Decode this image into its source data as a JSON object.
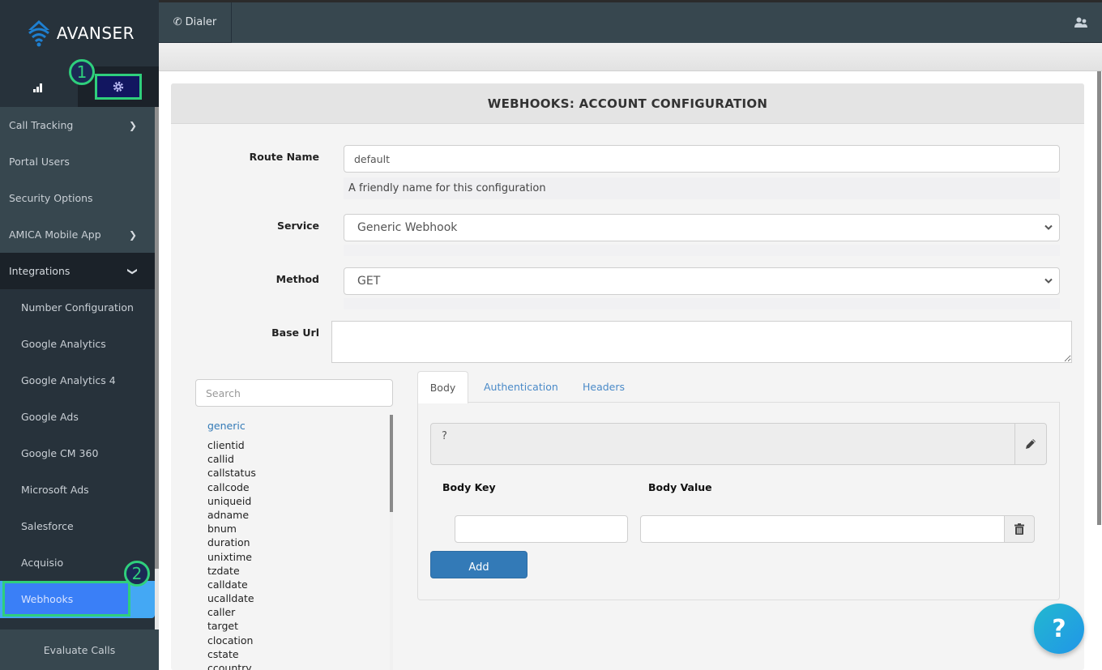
{
  "brand": {
    "name": "AVANSER"
  },
  "sidebar": {
    "tabs": [
      {
        "icon": "bar-chart-icon",
        "label": "Reports"
      },
      {
        "icon": "gear-icon",
        "label": "Settings"
      }
    ],
    "items": [
      {
        "label": "Call Tracking",
        "chevron": "›"
      },
      {
        "label": "Portal Users"
      },
      {
        "label": "Security Options"
      },
      {
        "label": "AMICA Mobile App",
        "chevron": "›"
      },
      {
        "label": "Integrations",
        "chevron": "⌄"
      }
    ],
    "integrations": [
      "Number Configuration",
      "Google Analytics",
      "Google Analytics 4",
      "Google Ads",
      "Google CM 360",
      "Microsoft Ads",
      "Salesforce",
      "Acquisio",
      "Webhooks"
    ],
    "active": "Webhooks",
    "footer": "Evaluate Calls",
    "annotations": {
      "settings": "1",
      "webhooks": "2"
    }
  },
  "topbar": {
    "dialer": "Dialer"
  },
  "page": {
    "title": "WEBHOOKS: ACCOUNT CONFIGURATION",
    "route_name_label": "Route Name",
    "route_name_value": "default",
    "route_name_help": "A friendly name for this configuration",
    "service_label": "Service",
    "service_value": "Generic Webhook",
    "method_label": "Method",
    "method_value": "GET",
    "base_url_label": "Base Url",
    "base_url_value": ""
  },
  "variables": {
    "search_placeholder": "Search",
    "group": "generic",
    "items": [
      "clientid",
      "callid",
      "callstatus",
      "callcode",
      "uniqueid",
      "adname",
      "bnum",
      "duration",
      "unixtime",
      "tzdate",
      "calldate",
      "ucalldate",
      "caller",
      "target",
      "clocation",
      "cstate",
      "ccountry"
    ]
  },
  "tabs": [
    {
      "label": "Body",
      "active": true
    },
    {
      "label": "Authentication"
    },
    {
      "label": "Headers"
    }
  ],
  "body": {
    "preview": "?",
    "key_label": "Body Key",
    "value_label": "Body Value",
    "key_value": "",
    "value_value": "",
    "add_label": "Add"
  },
  "help_fab": "?"
}
